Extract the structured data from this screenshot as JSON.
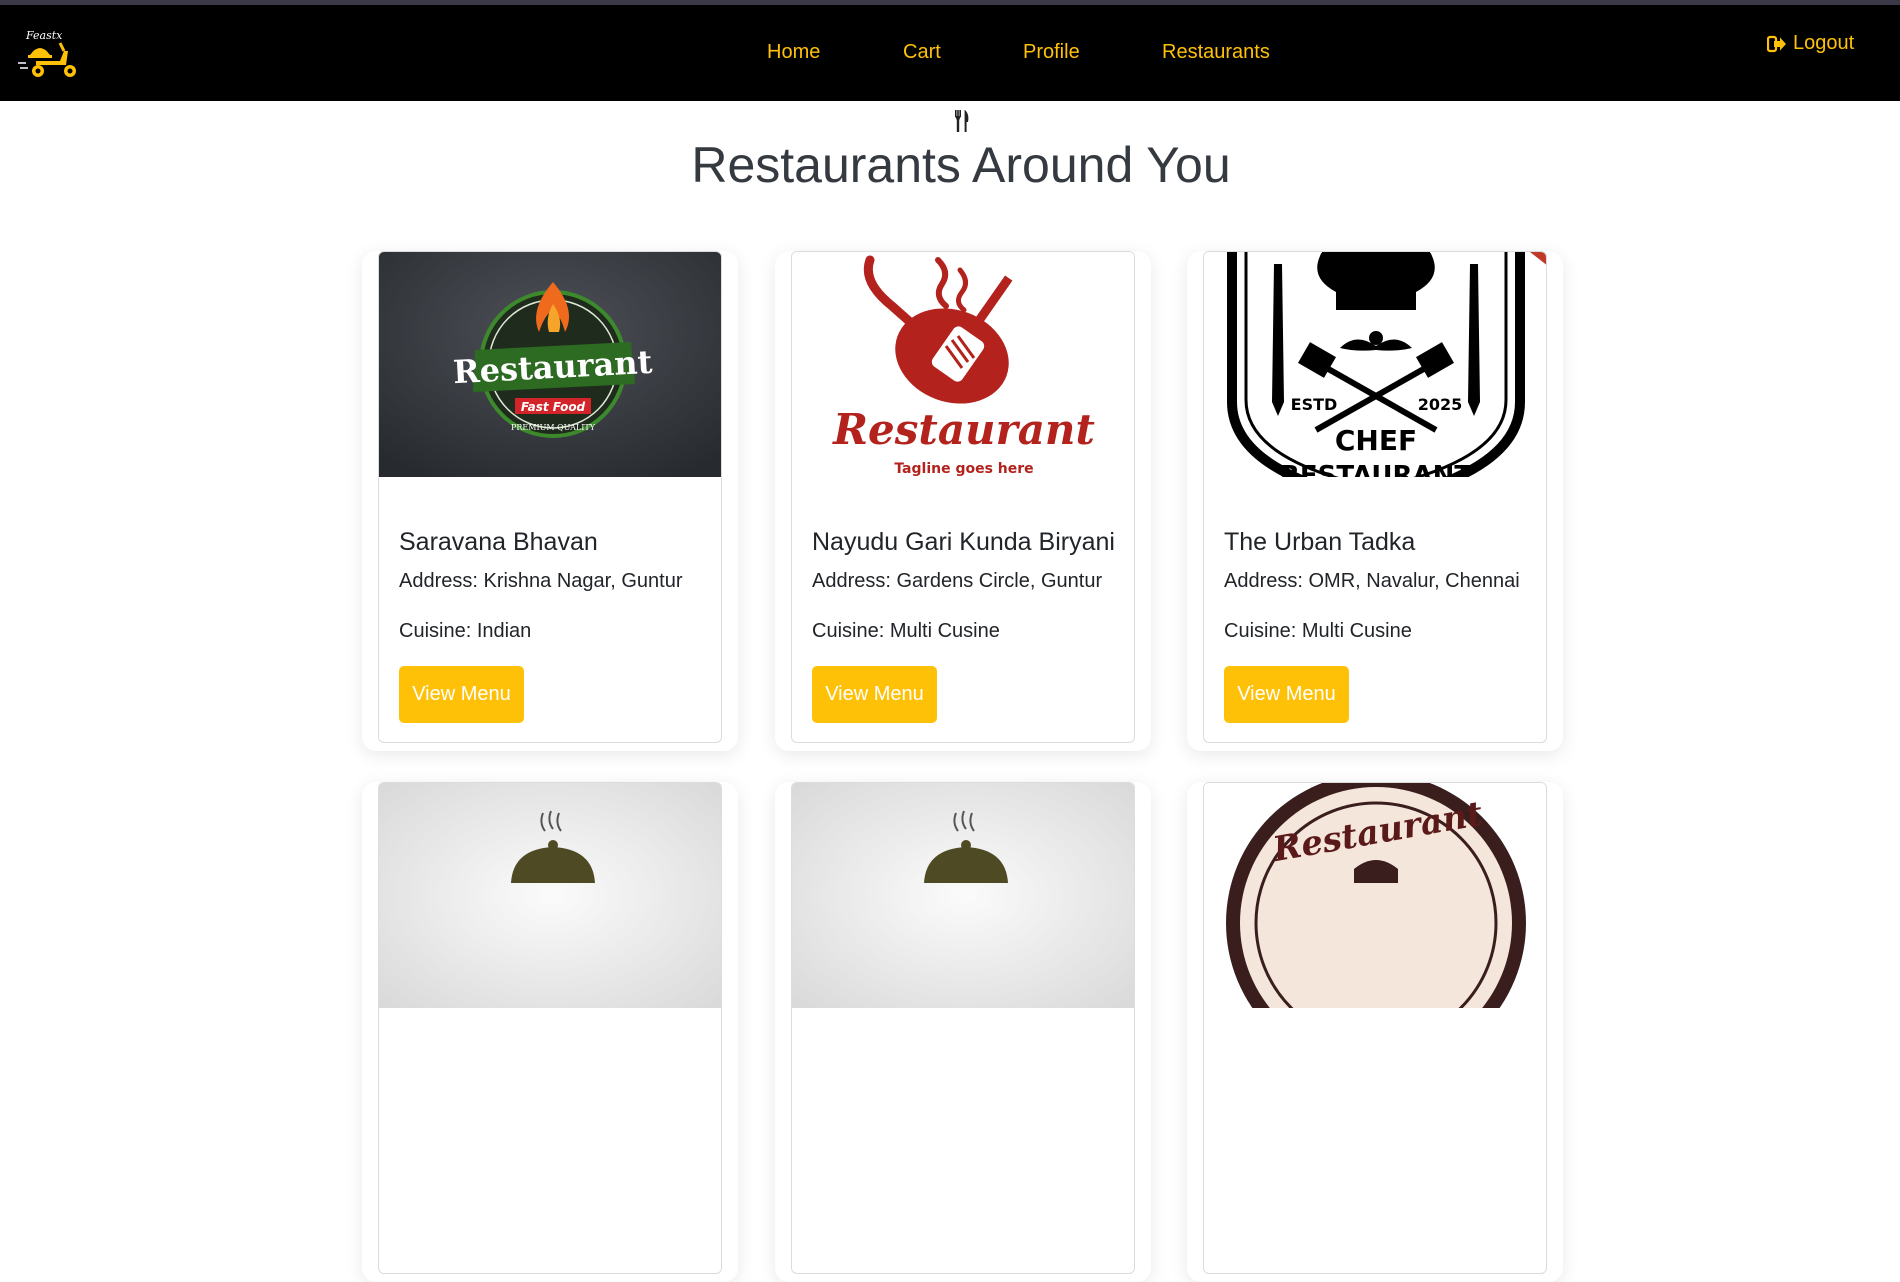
{
  "navbar": {
    "brand_text": "Feastx",
    "links": [
      "Home",
      "Cart",
      "Profile",
      "Restaurants"
    ],
    "logout_label": "Logout",
    "accent_color": "#ffc107"
  },
  "page": {
    "title": "Restaurants Around You"
  },
  "restaurants": [
    {
      "name": "Saravana Bhavan",
      "address": "Address: Krishna Nagar, Guntur",
      "cuisine": "Cuisine: Indian",
      "button": "View Menu",
      "logo": {
        "word": "Restaurant",
        "sub": "Fast Food",
        "tag": "PREMIUM QUALITY"
      }
    },
    {
      "name": "Nayudu Gari Kunda Biryani",
      "address": "Address: Gardens Circle, Guntur",
      "cuisine": "Cuisine: Multi Cusine",
      "button": "View Menu",
      "logo": {
        "word": "Restaurant",
        "tag": "Tagline goes here"
      }
    },
    {
      "name": "The Urban Tadka",
      "address": "Address: OMR, Navalur, Chennai",
      "cuisine": "Cuisine: Multi Cusine",
      "button": "View Menu",
      "logo": {
        "estd": "ESTD",
        "year": "2025",
        "word": "CHEF",
        "sub": "RESTAURANT"
      }
    },
    {
      "logo": {}
    },
    {
      "logo": {}
    },
    {
      "logo": {
        "word": "Restaurant"
      }
    }
  ]
}
